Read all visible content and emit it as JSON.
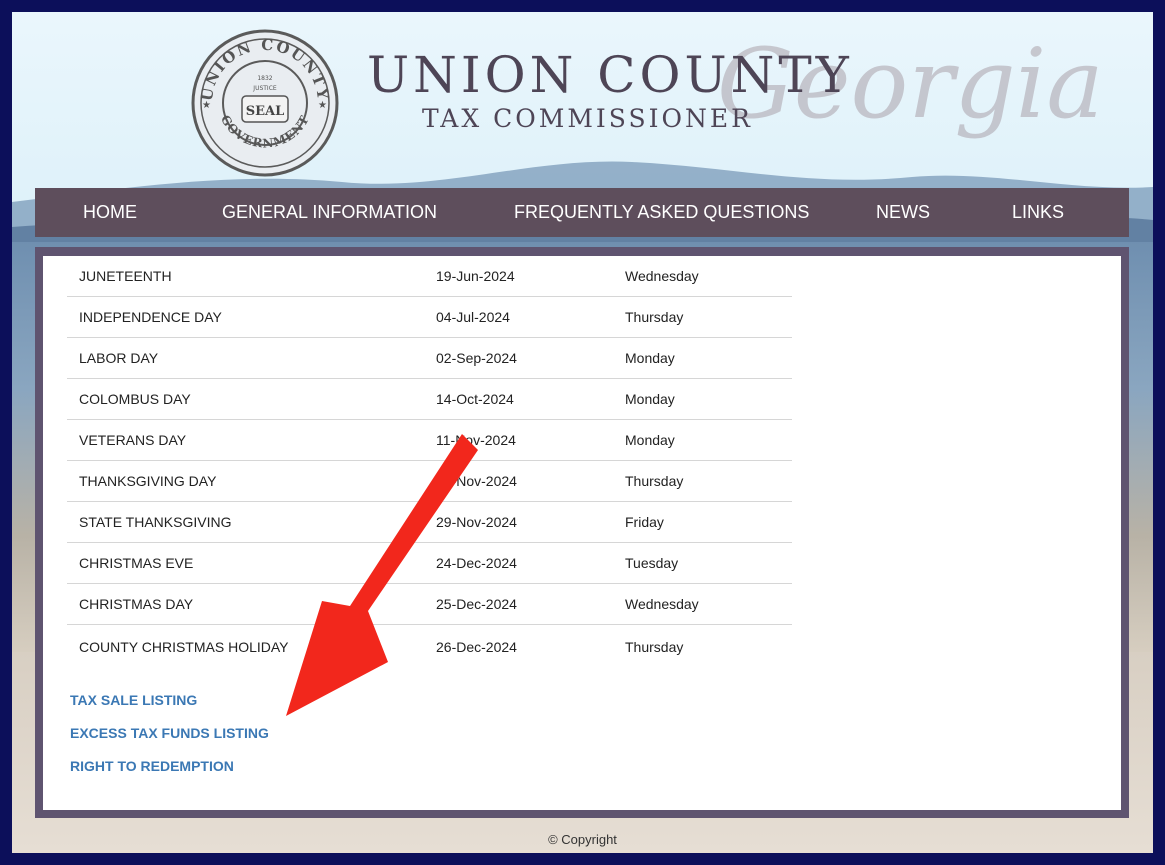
{
  "header": {
    "title": "UNION COUNTY",
    "subtitle": "TAX COMMISSIONER",
    "script_text": "Georgia",
    "seal": {
      "top_text": "UNION COUNTY",
      "bottom_text": "GOVERNMENT",
      "center_text": "SEAL",
      "year": "1832",
      "ribbon": "JUSTICE"
    }
  },
  "nav": {
    "items": [
      {
        "label": "HOME"
      },
      {
        "label": "GENERAL INFORMATION"
      },
      {
        "label": "FREQUENTLY ASKED QUESTIONS"
      },
      {
        "label": "NEWS"
      },
      {
        "label": "LINKS"
      }
    ]
  },
  "holidays": {
    "rows": [
      {
        "name": "JUNETEENTH",
        "date": "19-Jun-2024",
        "day": "Wednesday"
      },
      {
        "name": "INDEPENDENCE DAY",
        "date": "04-Jul-2024",
        "day": "Thursday"
      },
      {
        "name": "LABOR DAY",
        "date": "02-Sep-2024",
        "day": "Monday"
      },
      {
        "name": "COLOMBUS DAY",
        "date": "14-Oct-2024",
        "day": "Monday"
      },
      {
        "name": "VETERANS DAY",
        "date": "11-Nov-2024",
        "day": "Monday"
      },
      {
        "name": "THANKSGIVING DAY",
        "date": "28-Nov-2024",
        "day": "Thursday"
      },
      {
        "name": "STATE THANKSGIVING",
        "date": "29-Nov-2024",
        "day": "Friday"
      },
      {
        "name": "CHRISTMAS EVE",
        "date": "24-Dec-2024",
        "day": "Tuesday"
      },
      {
        "name": "CHRISTMAS DAY",
        "date": "25-Dec-2024",
        "day": "Wednesday"
      },
      {
        "name": "COUNTY CHRISTMAS HOLIDAY",
        "date": "26-Dec-2024",
        "day": "Thursday"
      }
    ]
  },
  "links": [
    {
      "label": "TAX SALE LISTING"
    },
    {
      "label": "EXCESS TAX FUNDS LISTING"
    },
    {
      "label": "RIGHT TO REDEMPTION"
    }
  ],
  "footer": {
    "text": "© Copyright"
  },
  "colors": {
    "border": "#0c0f5a",
    "nav_bg": "#5e4e5c",
    "link": "#3b78b4",
    "arrow": "#f2271c"
  }
}
